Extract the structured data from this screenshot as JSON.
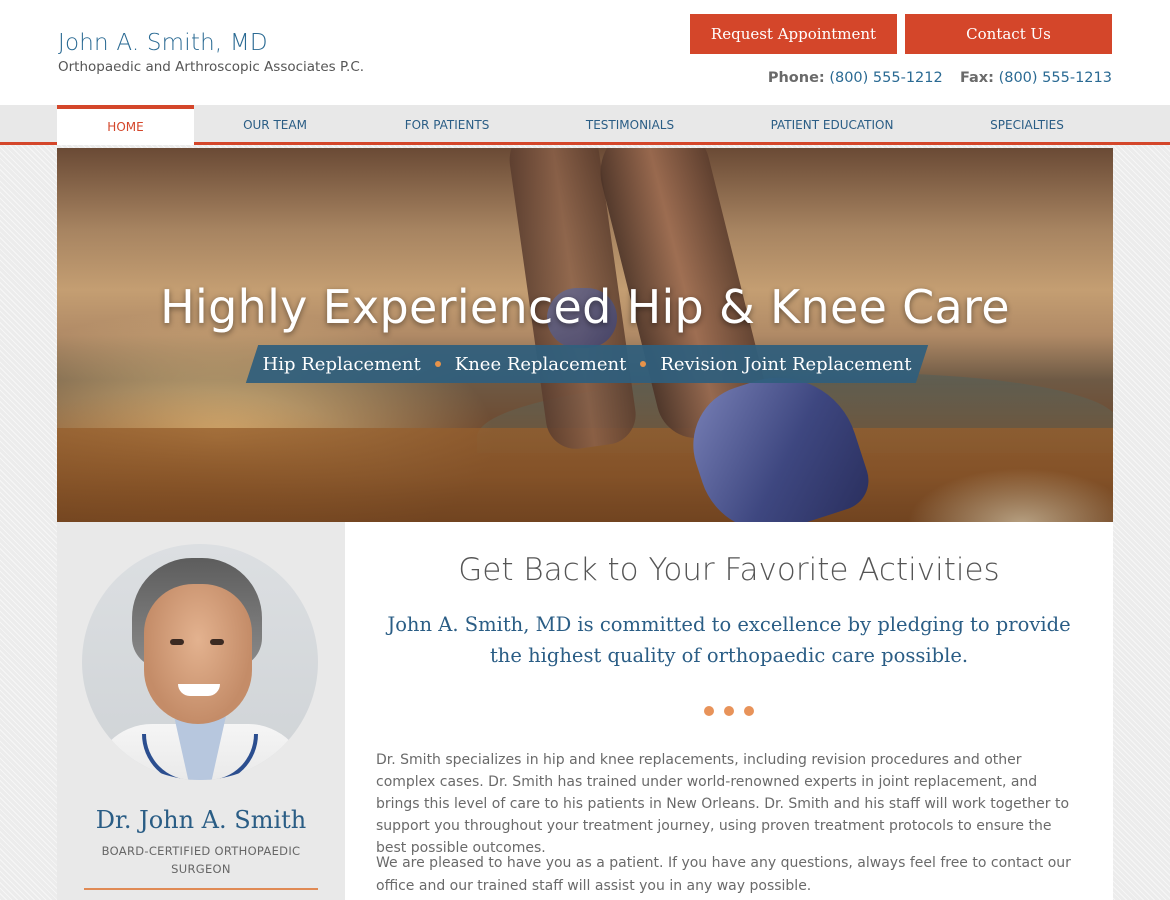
{
  "header": {
    "brand_name": "John A. Smith, MD",
    "brand_sub": "Orthopaedic and Arthroscopic Associates P.C.",
    "request_label": "Request Appointment",
    "contact_label": "Contact Us",
    "phone_label": "Phone:",
    "phone": "(800) 555-1212",
    "fax_label": "Fax:",
    "fax": "(800) 555-1213"
  },
  "nav": {
    "items": [
      {
        "label": "HOME",
        "active": true
      },
      {
        "label": "OUR TEAM"
      },
      {
        "label": "FOR PATIENTS"
      },
      {
        "label": "TESTIMONIALS"
      },
      {
        "label": "PATIENT EDUCATION"
      },
      {
        "label": "SPECIALTIES"
      }
    ]
  },
  "hero": {
    "title": "Highly Experienced Hip & Knee Care",
    "services": [
      "Hip Replacement",
      "Knee Replacement",
      "Revision Joint Replacement"
    ]
  },
  "sidebar": {
    "doctor_name": "Dr. John A. Smith",
    "doctor_title": "BOARD-CERTIFIED ORTHOPAEDIC SURGEON"
  },
  "main": {
    "heading": "Get Back to Your Favorite Activities",
    "lead": "John A. Smith, MD is committed to excellence by pledging to provide the highest quality of orthopaedic care possible.",
    "paragraph1": "Dr. Smith specializes in hip and knee replacements, including revision procedures and other complex cases. Dr. Smith has trained under world-renowned experts in joint replacement, and brings this level of care to his patients in New Orleans. Dr. Smith and his staff will work together to support you throughout your treatment journey, using proven treatment protocols to ensure the best possible outcomes.",
    "paragraph2": "We are pleased to have you as a patient. If you have any questions, always feel free to contact our office and our trained staff will assist you in any way possible."
  },
  "colors": {
    "accent": "#d4462a",
    "brand_blue": "#2a5d85",
    "dot_orange": "#e8935a"
  }
}
